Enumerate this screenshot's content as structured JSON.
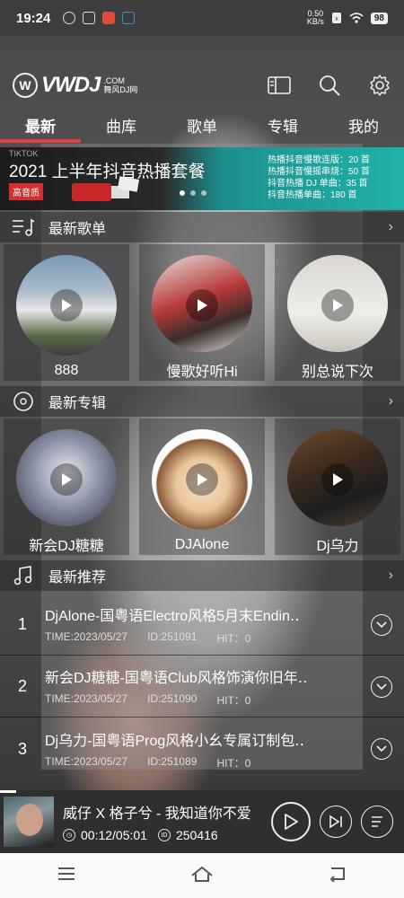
{
  "status_bar": {
    "time": "19:24",
    "net_speed_value": "0.50",
    "net_speed_unit": "KB/s",
    "battery": "98"
  },
  "header": {
    "logo_text": "VWDJ",
    "logo_com": ".COM",
    "logo_sub": "舞风DJ网"
  },
  "tabs": [
    {
      "label": "最新"
    },
    {
      "label": "曲库"
    },
    {
      "label": "歌单"
    },
    {
      "label": "专辑"
    },
    {
      "label": "我的"
    }
  ],
  "banner": {
    "tiktok": "TIKTOK",
    "title": "2021 上半年抖音热播套餐",
    "badge": "高音质",
    "lines": [
      "热播抖音慢歌连版：20 首",
      "热播抖音慢摇串烧：50 首",
      "抖音热播 DJ 单曲：35 首",
      "抖音热播单曲：180 首"
    ]
  },
  "sections": {
    "playlists": {
      "title": "最新歌单",
      "items": [
        {
          "label": "888"
        },
        {
          "label": "慢歌好听Hi"
        },
        {
          "label": "别总说下次"
        }
      ]
    },
    "albums": {
      "title": "最新专辑",
      "items": [
        {
          "label": "新会DJ糖糖"
        },
        {
          "label": "DJAlone"
        },
        {
          "label": "Dj乌力"
        }
      ]
    },
    "recommended": {
      "title": "最新推荐",
      "items": [
        {
          "num": "1",
          "title": "DjAlone-国粤语Electro风格5月末Endin‥",
          "time": "TIME:2023/05/27",
          "id": "ID:251091",
          "hit": "HIT：0"
        },
        {
          "num": "2",
          "title": "新会DJ糖糖-国粤语Club风格饰演你旧年‥",
          "time": "TIME:2023/05/27",
          "id": "ID:251090",
          "hit": "HIT：0"
        },
        {
          "num": "3",
          "title": "Dj乌力-国粤语Prog风格小幺专属订制包‥",
          "time": "TIME:2023/05/27",
          "id": "ID:251089",
          "hit": "HIT：0"
        }
      ]
    }
  },
  "player": {
    "title": "威仔 X 格子兮 - 我知道你不爱",
    "elapsed": "00:12/05:01",
    "id": "250416",
    "progress": 0.04
  },
  "colors": {
    "accent": "#e04040",
    "banner_teal": "#20b2aa"
  }
}
